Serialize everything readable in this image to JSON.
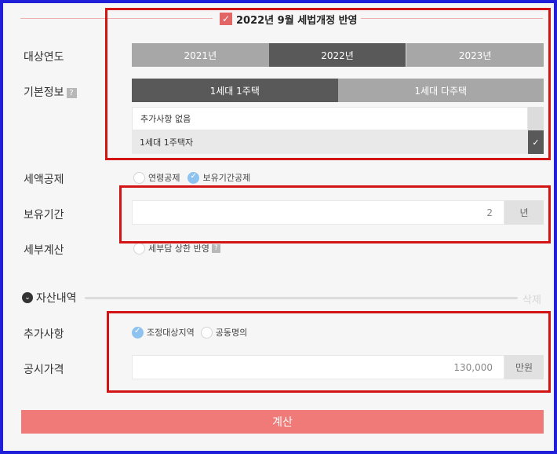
{
  "header": {
    "tax_reform_label": "2022년 9월 세법개정 반영"
  },
  "target_year": {
    "label": "대상연도",
    "options": [
      "2021년",
      "2022년",
      "2023년"
    ],
    "selected": "2022년"
  },
  "basic_info": {
    "label": "기본정보",
    "help": "?",
    "options": [
      "1세대 1주택",
      "1세대 다주택"
    ],
    "selected": "1세대 1주택",
    "sub_options": [
      "추가사항 없음",
      "1세대 1주택자"
    ],
    "sub_selected": "1세대 1주택자"
  },
  "tax_deduction": {
    "label": "세액공제",
    "options": [
      "연령공제",
      "보유기간공제"
    ],
    "checked": "보유기간공제"
  },
  "holding_period": {
    "label": "보유기간",
    "value": "2",
    "unit": "년"
  },
  "detail_calc": {
    "label": "세부계산",
    "option": "세부담 상한 반영",
    "help": "?"
  },
  "assets": {
    "section_label": "자산내역",
    "delete_label": "삭제"
  },
  "additional": {
    "label": "추가사항",
    "options": [
      "조정대상지역",
      "공동명의"
    ],
    "checked": "조정대상지역"
  },
  "public_price": {
    "label": "공시가격",
    "value": "130,000",
    "unit": "만원"
  },
  "submit": {
    "label": "계산"
  },
  "colors": {
    "highlight": "#d21414",
    "frame": "#1f1fd9",
    "accent": "#f07a78",
    "active": "#595959",
    "inactive": "#a7a7a7"
  }
}
